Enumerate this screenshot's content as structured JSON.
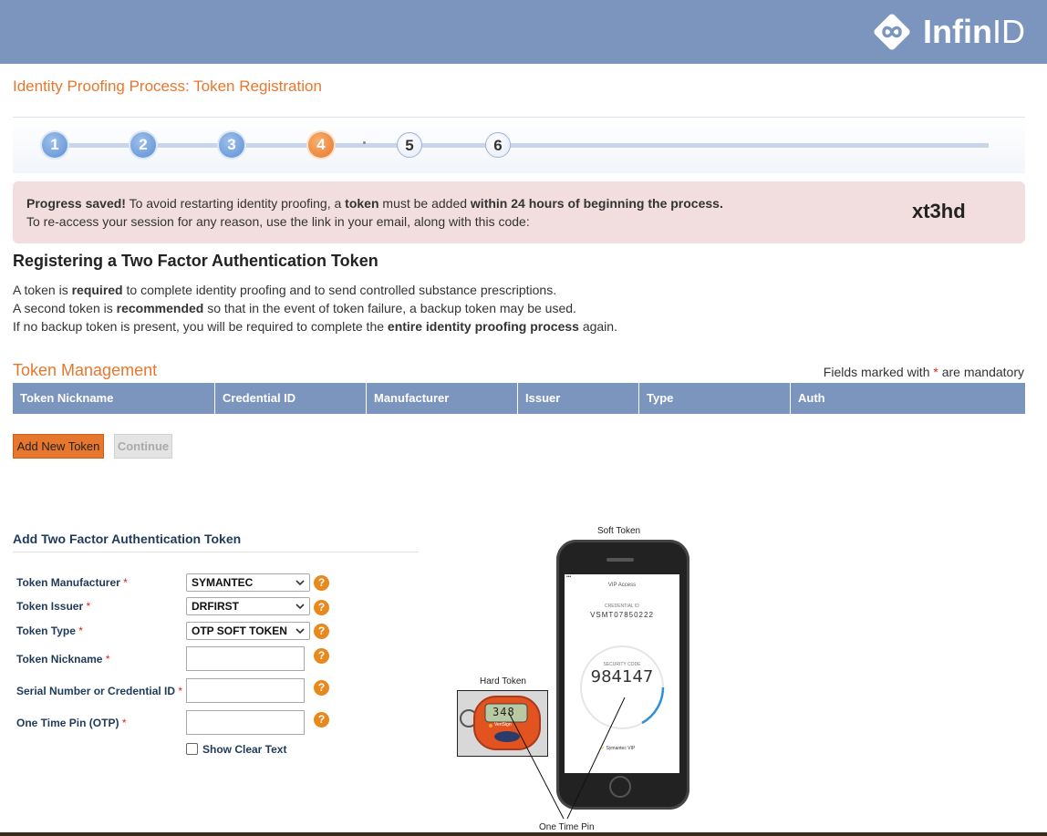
{
  "brand": {
    "name_bold": "Infin",
    "name_thin": "ID"
  },
  "page_title": "Identity Proofing Process: Token Registration",
  "steps": [
    {
      "label": "1",
      "state": "done"
    },
    {
      "label": "2",
      "state": "done"
    },
    {
      "label": "3",
      "state": "done"
    },
    {
      "label": "4",
      "state": "current"
    },
    {
      "label": "5",
      "state": "todo"
    },
    {
      "label": "6",
      "state": "todo"
    }
  ],
  "alert": {
    "line1_a": "Progress saved!",
    "line1_b": " To avoid restarting identity proofing, a ",
    "line1_c": "token",
    "line1_d": " must be added ",
    "line1_e": "within 24 hours of beginning the process.",
    "line2": "To re-access your session for any reason, use the link in your email, along with this code:",
    "code": "xt3hd"
  },
  "section_heading": "Registering a Two Factor Authentication Token",
  "paragraphs": {
    "p1_a": "A token is ",
    "p1_b": "required",
    "p1_c": " to complete identity proofing and to send controlled substance prescriptions.",
    "p2_a": "A second token is ",
    "p2_b": "recommended",
    "p2_c": " so that in the event of token failure, a backup token may be used.",
    "p3_a": "If no backup token is present, you will be required to complete the ",
    "p3_b": "entire identity proofing process",
    "p3_c": " again."
  },
  "token_management": {
    "title": "Token Management",
    "mandatory_a": "Fields marked with ",
    "mandatory_star": "*",
    "mandatory_b": " are mandatory",
    "columns": [
      "Token Nickname",
      "Credential ID",
      "Manufacturer",
      "Issuer",
      "Type",
      "Auth"
    ],
    "add_button": "Add New Token",
    "continue_button": "Continue"
  },
  "form": {
    "title": "Add Two Factor Authentication Token",
    "fields": {
      "manufacturer": {
        "label": "Token Manufacturer",
        "value": "SYMANTEC"
      },
      "issuer": {
        "label": "Token Issuer",
        "value": "DRFIRST"
      },
      "type": {
        "label": "Token Type",
        "value": "OTP SOFT TOKEN"
      },
      "nickname": {
        "label": "Token Nickname",
        "value": ""
      },
      "serial": {
        "label": "Serial Number or Credential ID",
        "value": ""
      },
      "otp": {
        "label": "One Time Pin (OTP)",
        "value": ""
      }
    },
    "required_star": "*",
    "help_glyph": "?",
    "show_clear_text": "Show Clear Text"
  },
  "illustration": {
    "soft_token_label": "Soft Token",
    "hard_token_label": "Hard Token",
    "otp_label": "One Time Pin",
    "phone_header": "VIP Access",
    "phone_cred_label": "CREDENTIAL ID",
    "phone_cred_value": "VSMT07850222",
    "phone_code_label": "SECURITY CODE",
    "phone_code": "984147",
    "phone_footer": "Symantec VIP",
    "hard_display": "348",
    "hard_brand": "VeriSign"
  },
  "colors": {
    "header_blue": "#7c95bf",
    "accent_orange": "#e8772e",
    "alert_bg": "#f2dede",
    "required_red": "#d9251c"
  }
}
